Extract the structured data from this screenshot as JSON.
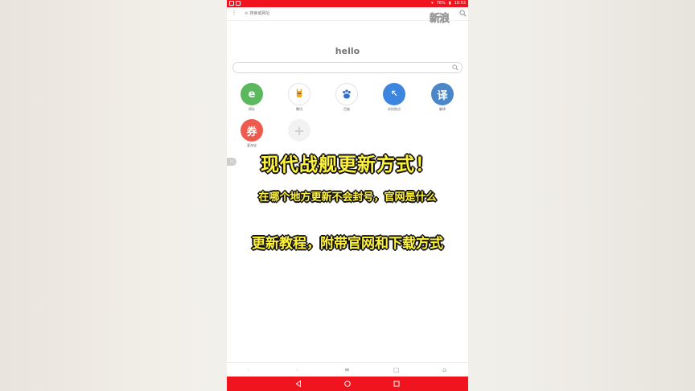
{
  "status_bar": {
    "battery": "76%",
    "time": "10:53"
  },
  "toolbar": {
    "url_placeholder": "搜索或网址",
    "logo": "新浪"
  },
  "home": {
    "greeting": "hello"
  },
  "shortcuts": [
    {
      "label": "网址",
      "glyph": "e",
      "color": "#5cb85c"
    },
    {
      "label": "腾讯",
      "glyph": "🦙",
      "color": "#ffffff"
    },
    {
      "label": "百度",
      "glyph": "🐾",
      "color": "#ffffff"
    },
    {
      "label": "实时热点",
      "glyph": "⇖",
      "color": "#3d86e0"
    },
    {
      "label": "翻译",
      "glyph": "译",
      "color": "#4a86c8"
    },
    {
      "label": "爱淘宝",
      "glyph": "券",
      "color": "#ef5a4f"
    },
    {
      "label": "",
      "glyph": "+",
      "color": "#f2f2f2"
    }
  ],
  "side_tab": {
    "label": "<"
  },
  "overlay": {
    "line1": "现代战舰更新方式！",
    "line2": "在哪个地方更新不会封号，官网是什么",
    "line3": "更新教程，附带官网和下载方式"
  },
  "browser_nav": {
    "back": "‹",
    "forward": "›",
    "menu": "≡",
    "tabs": "□",
    "home": "⌂"
  },
  "colors": {
    "status_red": "#f0141e",
    "overlay_yellow": "#fff23a"
  }
}
